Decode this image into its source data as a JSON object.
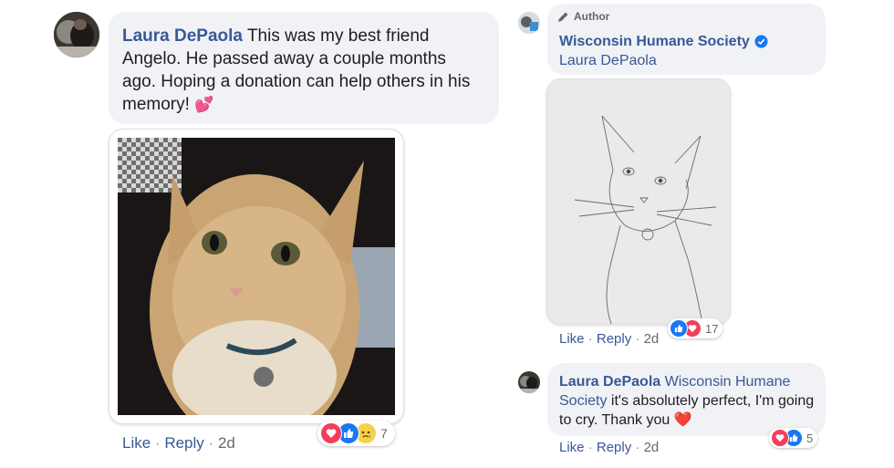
{
  "left_comment": {
    "author": "Laura DePaola",
    "text": "This was my best friend Angelo. He passed away a couple months ago. Hoping a donation can help others in his memory!",
    "emoji": "💕",
    "like_label": "Like",
    "reply_label": "Reply",
    "time": "2d",
    "reaction_count": "7",
    "reactions": [
      "love-icon",
      "like-icon",
      "sad-icon"
    ]
  },
  "right_reply": {
    "badge": "Author",
    "author": "Wisconsin Humane Society",
    "mention": "Laura DePaola",
    "like_label": "Like",
    "reply_label": "Reply",
    "time": "2d",
    "reaction_count": "17",
    "reactions": [
      "like-icon",
      "love-icon"
    ]
  },
  "right_reply2": {
    "author": "Laura DePaola",
    "mention": "Wisconsin Humane Society",
    "text": "it's absolutely perfect, I'm going to cry. Thank you",
    "emoji": "❤️",
    "like_label": "Like",
    "reply_label": "Reply",
    "time": "2d",
    "reaction_count": "5",
    "reactions": [
      "love-icon",
      "like-icon"
    ]
  },
  "colors": {
    "link": "#385898",
    "bubble": "#f0f2f5",
    "love": "#f33e58",
    "like": "#1877f2",
    "verified": "#1877f2"
  }
}
